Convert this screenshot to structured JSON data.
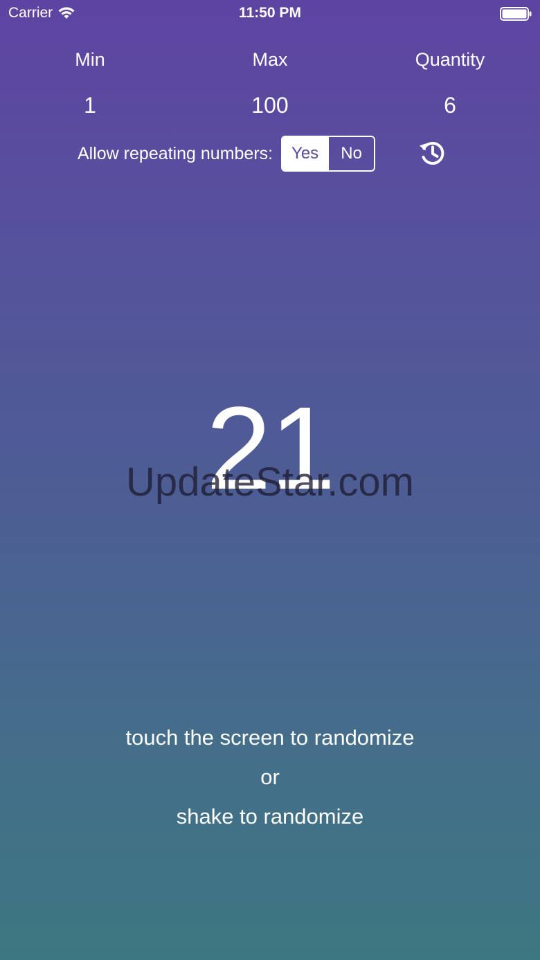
{
  "status_bar": {
    "carrier": "Carrier",
    "time": "11:50 PM"
  },
  "settings": {
    "min": {
      "label": "Min",
      "value": "1"
    },
    "max": {
      "label": "Max",
      "value": "100"
    },
    "quantity": {
      "label": "Quantity",
      "value": "6"
    }
  },
  "repeat": {
    "label": "Allow repeating numbers:",
    "options": [
      "Yes",
      "No"
    ],
    "selected": "Yes"
  },
  "history_icon": "history-icon",
  "result": "21",
  "watermark": "UpdateStar.com",
  "instructions": {
    "line1": "touch the screen to randomize",
    "line2": "or",
    "line3": "shake to randomize"
  },
  "colors": {
    "gradient_top": "#5e44a2",
    "gradient_bottom": "#3d7781",
    "selected_segment_text": "#5a4aa0"
  }
}
